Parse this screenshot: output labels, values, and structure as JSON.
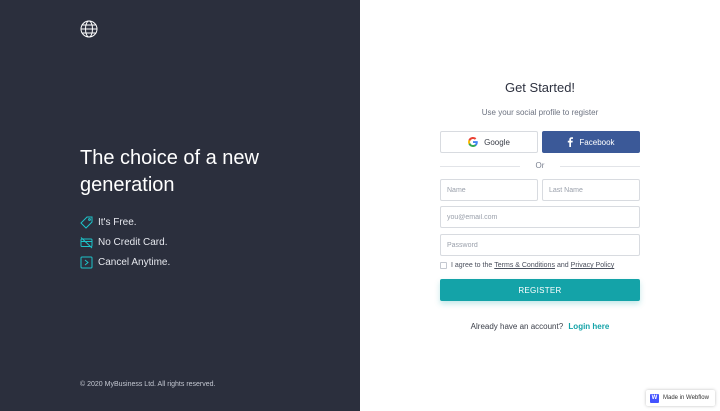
{
  "left_panel": {
    "logo_icon": "globe-icon",
    "headline": "The choice of a new generation",
    "features": [
      {
        "icon": "tag-icon",
        "label": "It's Free."
      },
      {
        "icon": "no-credit-card-icon",
        "label": "No Credit Card."
      },
      {
        "icon": "exit-icon",
        "label": "Cancel Anytime."
      }
    ],
    "copyright": "© 2020 MyBusiness Ltd. All rights reserved."
  },
  "form": {
    "title": "Get Started!",
    "subtitle": "Use your social profile to register",
    "google_label": "Google",
    "facebook_label": "Facebook",
    "or_text": "Or",
    "name_placeholder": "Name",
    "last_name_placeholder": "Last Name",
    "email_placeholder": "you@email.com",
    "password_placeholder": "Password",
    "agree_prefix": "I agree to the",
    "terms_link": "Terms & Conditions",
    "agree_and": "and",
    "privacy_link": "Privacy Policy",
    "register_label": "REGISTER",
    "login_prompt": "Already have an account?",
    "login_link": "Login here"
  },
  "badge": {
    "icon": "webflow-icon",
    "logo_letter": "W",
    "label": "Made in Webflow"
  },
  "colors": {
    "left_bg": "#2b2f3d",
    "accent": "#14a3a8",
    "facebook": "#3b5998"
  }
}
